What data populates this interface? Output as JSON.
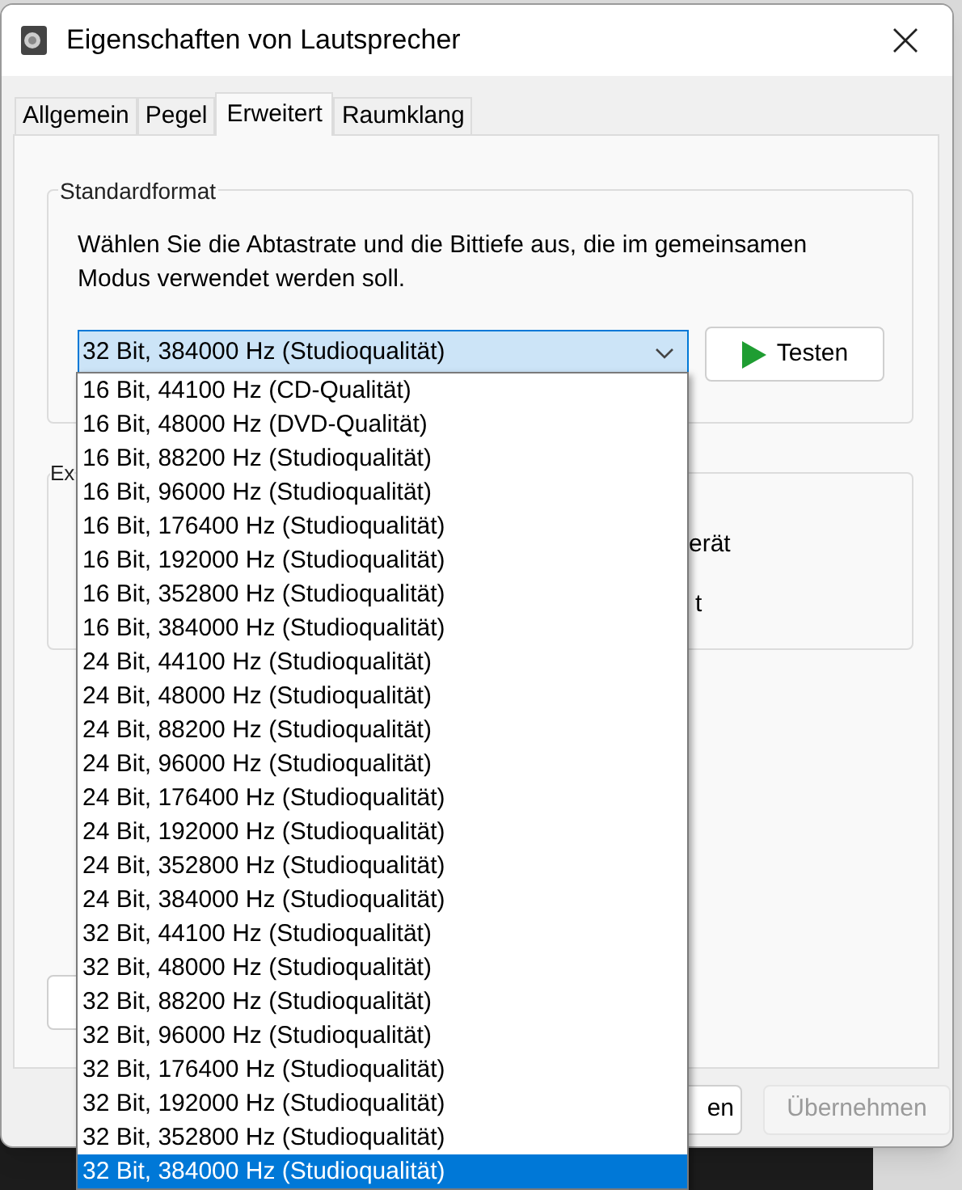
{
  "window": {
    "title": "Eigenschaften von Lautsprecher"
  },
  "tabs": [
    {
      "label": "Allgemein",
      "selected": false
    },
    {
      "label": "Pegel",
      "selected": false
    },
    {
      "label": "Erweitert",
      "selected": true
    },
    {
      "label": "Raumklang",
      "selected": false
    }
  ],
  "standard_format": {
    "legend": "Standardformat",
    "description": "Wählen Sie die Abtastrate und die Bittiefe aus, die im gemeinsamen Modus verwendet werden soll.",
    "format_select": {
      "value": "32 Bit, 384000 Hz (Studioqualität)",
      "expanded": true
    },
    "test_button": "Testen"
  },
  "format_options": [
    {
      "label": "16 Bit, 44100 Hz (CD-Qualität)",
      "selected": false
    },
    {
      "label": "16 Bit, 48000 Hz (DVD-Qualität)",
      "selected": false
    },
    {
      "label": "16 Bit, 88200 Hz (Studioqualität)",
      "selected": false
    },
    {
      "label": "16 Bit, 96000 Hz (Studioqualität)",
      "selected": false
    },
    {
      "label": "16 Bit, 176400 Hz (Studioqualität)",
      "selected": false
    },
    {
      "label": "16 Bit, 192000 Hz (Studioqualität)",
      "selected": false
    },
    {
      "label": "16 Bit, 352800 Hz (Studioqualität)",
      "selected": false
    },
    {
      "label": "16 Bit, 384000 Hz (Studioqualität)",
      "selected": false
    },
    {
      "label": "24 Bit, 44100 Hz (Studioqualität)",
      "selected": false
    },
    {
      "label": "24 Bit, 48000 Hz (Studioqualität)",
      "selected": false
    },
    {
      "label": "24 Bit, 88200 Hz (Studioqualität)",
      "selected": false
    },
    {
      "label": "24 Bit, 96000 Hz (Studioqualität)",
      "selected": false
    },
    {
      "label": "24 Bit, 176400 Hz (Studioqualität)",
      "selected": false
    },
    {
      "label": "24 Bit, 192000 Hz (Studioqualität)",
      "selected": false
    },
    {
      "label": "24 Bit, 352800 Hz (Studioqualität)",
      "selected": false
    },
    {
      "label": "24 Bit, 384000 Hz (Studioqualität)",
      "selected": false
    },
    {
      "label": "32 Bit, 44100 Hz (Studioqualität)",
      "selected": false
    },
    {
      "label": "32 Bit, 48000 Hz (Studioqualität)",
      "selected": false
    },
    {
      "label": "32 Bit, 88200 Hz (Studioqualität)",
      "selected": false
    },
    {
      "label": "32 Bit, 96000 Hz (Studioqualität)",
      "selected": false
    },
    {
      "label": "32 Bit, 176400 Hz (Studioqualität)",
      "selected": false
    },
    {
      "label": "32 Bit, 192000 Hz (Studioqualität)",
      "selected": false
    },
    {
      "label": "32 Bit, 352800 Hz (Studioqualität)",
      "selected": false
    },
    {
      "label": "32 Bit, 384000 Hz (Studioqualität)",
      "selected": true
    }
  ],
  "exclusive_group": {
    "legend": "Ex",
    "texts": [
      "erät",
      "t"
    ]
  },
  "buttons": [
    {
      "label": "en",
      "disabled": false
    },
    {
      "label": "Übernehmen",
      "disabled": true
    }
  ]
}
